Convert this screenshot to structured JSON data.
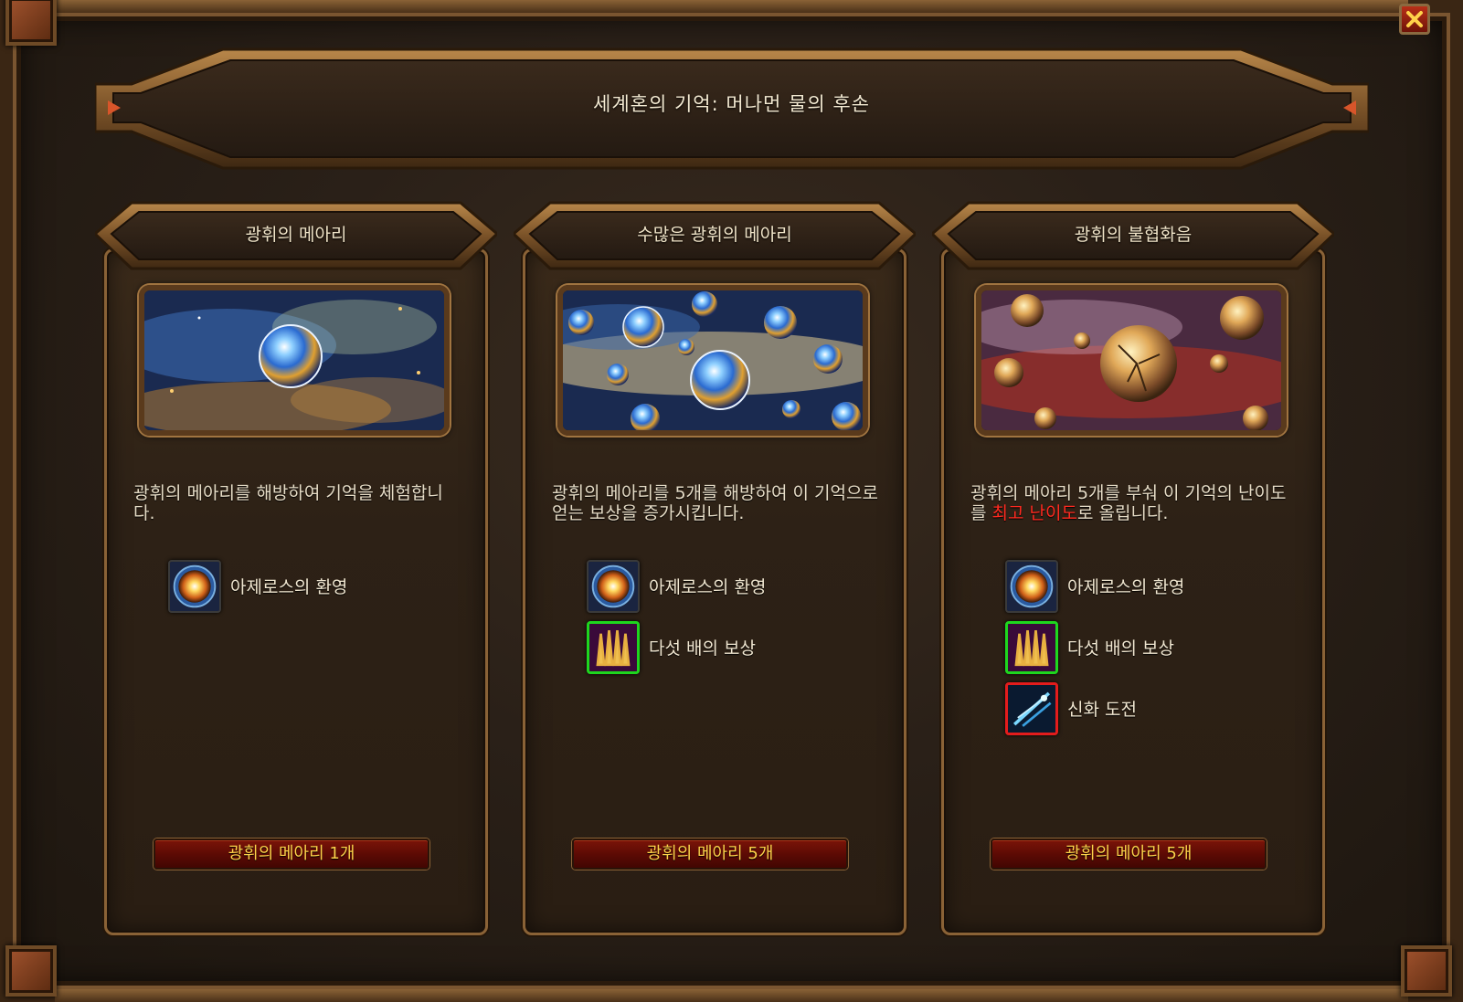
{
  "window": {
    "title": "세계혼의 기억: 머나먼 물의 후손",
    "close_icon": "close-x-icon"
  },
  "colors": {
    "accent_gold": "#ffd24a",
    "highlight_red": "#ff2a20",
    "border_green": "#1ed61e",
    "border_red": "#e31c1c"
  },
  "cards": [
    {
      "title": "광휘의 메아리",
      "image": "single-echo-orb-image",
      "description": "광휘의 메아리를 해방하여 기억을 체험합니다.",
      "rewards": [
        {
          "label": "아제로스의 환영",
          "icon": "azeroth-vision-icon"
        }
      ],
      "button_label": "광휘의 메아리 1개"
    },
    {
      "title": "수많은 광휘의 메아리",
      "image": "many-echo-orbs-image",
      "description": "광휘의 메아리를 5개를 해방하여 이 기억으로 얻는 보상을 증가시킵니다.",
      "rewards": [
        {
          "label": "아제로스의 환영",
          "icon": "azeroth-vision-icon"
        },
        {
          "label": "다섯 배의 보상",
          "icon": "fivefold-reward-icon"
        }
      ],
      "button_label": "광휘의 메아리 5개"
    },
    {
      "title": "광휘의 불협화음",
      "image": "cracked-orbs-image",
      "description_before": "광휘의 메아리 5개를 부숴 이 기억의 난이도를 ",
      "description_highlight": "최고 난이도",
      "description_after": "로 올립니다.",
      "rewards": [
        {
          "label": "아제로스의 환영",
          "icon": "azeroth-vision-icon"
        },
        {
          "label": "다섯 배의 보상",
          "icon": "fivefold-reward-icon"
        },
        {
          "label": "신화 도전",
          "icon": "mythic-challenge-icon"
        }
      ],
      "button_label": "광휘의 메아리 5개"
    }
  ]
}
